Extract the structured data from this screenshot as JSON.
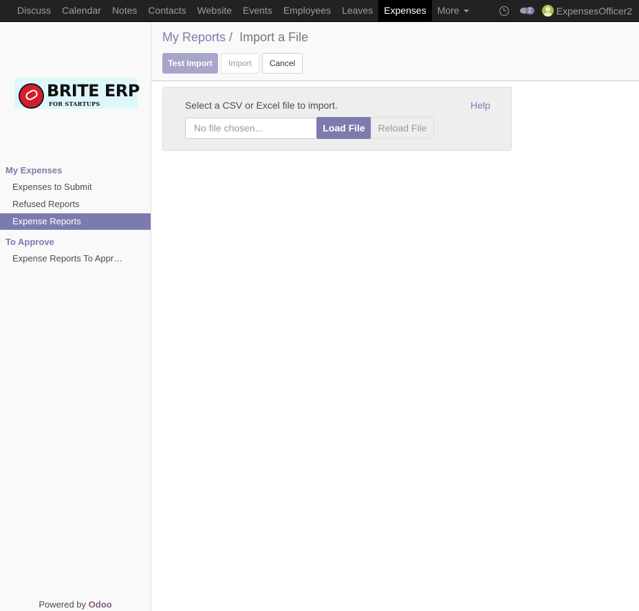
{
  "navbar": {
    "apps": [
      "Discuss",
      "Calendar",
      "Notes",
      "Contacts",
      "Website",
      "Events",
      "Employees",
      "Leaves",
      "Expenses",
      "More"
    ],
    "active_app": "Expenses",
    "chat_count": "2",
    "user_name": "ExpensesOfficer2",
    "icons": {
      "activity": "clock-icon",
      "messages": "chat-bubble-icon",
      "user": "user-avatar-icon"
    }
  },
  "sidebar": {
    "logo": {
      "brand": "BRITE ERP",
      "tagline": "FOR STARTUPS"
    },
    "sections": [
      {
        "title": "My Expenses",
        "items": [
          "Expenses to Submit",
          "Refused Reports",
          "Expense Reports"
        ]
      },
      {
        "title": "To Approve",
        "items": [
          "Expense Reports To Appr…"
        ]
      }
    ],
    "active_item": "Expense Reports",
    "powered_by": "Powered by",
    "powered_brand": "Odoo"
  },
  "control_panel": {
    "breadcrumb_parent": "My Reports",
    "breadcrumb_separator": "/",
    "breadcrumb_current": "Import a File",
    "buttons": {
      "test_import": "Test Import",
      "import": "Import",
      "cancel": "Cancel"
    }
  },
  "import_panel": {
    "label": "Select a CSV or Excel file to import.",
    "help": "Help",
    "file_placeholder": "No file chosen...",
    "load_button": "Load File",
    "reload_button": "Reload File"
  },
  "colors": {
    "accent": "#7c7bad",
    "navbar_bg": "#222222",
    "active_app_bg": "#000000",
    "odoo_brand": "#875a7b"
  }
}
